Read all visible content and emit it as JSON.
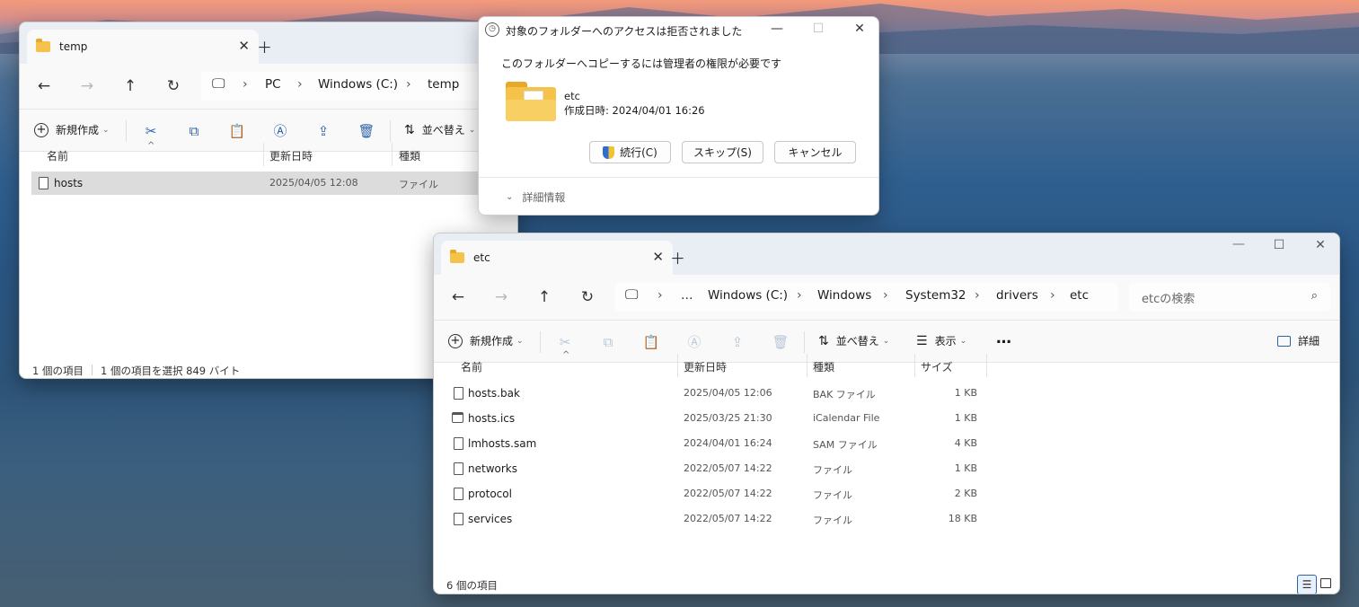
{
  "temp_window": {
    "tab_title": "temp",
    "breadcrumbs": [
      "PC",
      "Windows (C:)",
      "temp"
    ],
    "toolbar": {
      "new_label": "新規作成",
      "sort_label": "並べ替え"
    },
    "columns": [
      "名前",
      "更新日時",
      "種類"
    ],
    "files": [
      {
        "name": "hosts",
        "modified": "2025/04/05 12:08",
        "type": "ファイル"
      }
    ],
    "status": {
      "count": "1 個の項目",
      "selected": "1 個の項目を選択  849 バイト"
    }
  },
  "dialog": {
    "title": "対象のフォルダーへのアクセスは拒否されました",
    "message": "このフォルダーへコピーするには管理者の権限が必要です",
    "folder_name": "etc",
    "folder_created": "作成日時: 2024/04/01 16:26",
    "continue_label": "続行(C)",
    "skip_label": "スキップ(S)",
    "cancel_label": "キャンセル",
    "details_label": "詳細情報"
  },
  "etc_window": {
    "tab_title": "etc",
    "breadcrumbs": [
      "…",
      "Windows (C:)",
      "Windows",
      "System32",
      "drivers",
      "etc"
    ],
    "search_placeholder": "etcの検索",
    "toolbar": {
      "new_label": "新規作成",
      "sort_label": "並べ替え",
      "view_label": "表示",
      "more_label": "…",
      "details_label": "詳細"
    },
    "columns": [
      "名前",
      "更新日時",
      "種類",
      "サイズ"
    ],
    "files": [
      {
        "name": "hosts.bak",
        "modified": "2025/04/05 12:06",
        "type": "BAK ファイル",
        "size": "1 KB",
        "icon": "file-icon"
      },
      {
        "name": "hosts.ics",
        "modified": "2025/03/25 21:30",
        "type": "iCalendar File",
        "size": "1 KB",
        "icon": "calendar-icon"
      },
      {
        "name": "lmhosts.sam",
        "modified": "2024/04/01 16:24",
        "type": "SAM ファイル",
        "size": "4 KB",
        "icon": "file-icon"
      },
      {
        "name": "networks",
        "modified": "2022/05/07 14:22",
        "type": "ファイル",
        "size": "1 KB",
        "icon": "file-icon"
      },
      {
        "name": "protocol",
        "modified": "2022/05/07 14:22",
        "type": "ファイル",
        "size": "2 KB",
        "icon": "file-icon"
      },
      {
        "name": "services",
        "modified": "2022/05/07 14:22",
        "type": "ファイル",
        "size": "18 KB",
        "icon": "file-icon"
      }
    ],
    "status": {
      "count": "6 個の項目"
    }
  },
  "colors": {
    "accent": "#2c63a6",
    "folder": "#f5c24a",
    "selection": "#dcdcdc"
  }
}
